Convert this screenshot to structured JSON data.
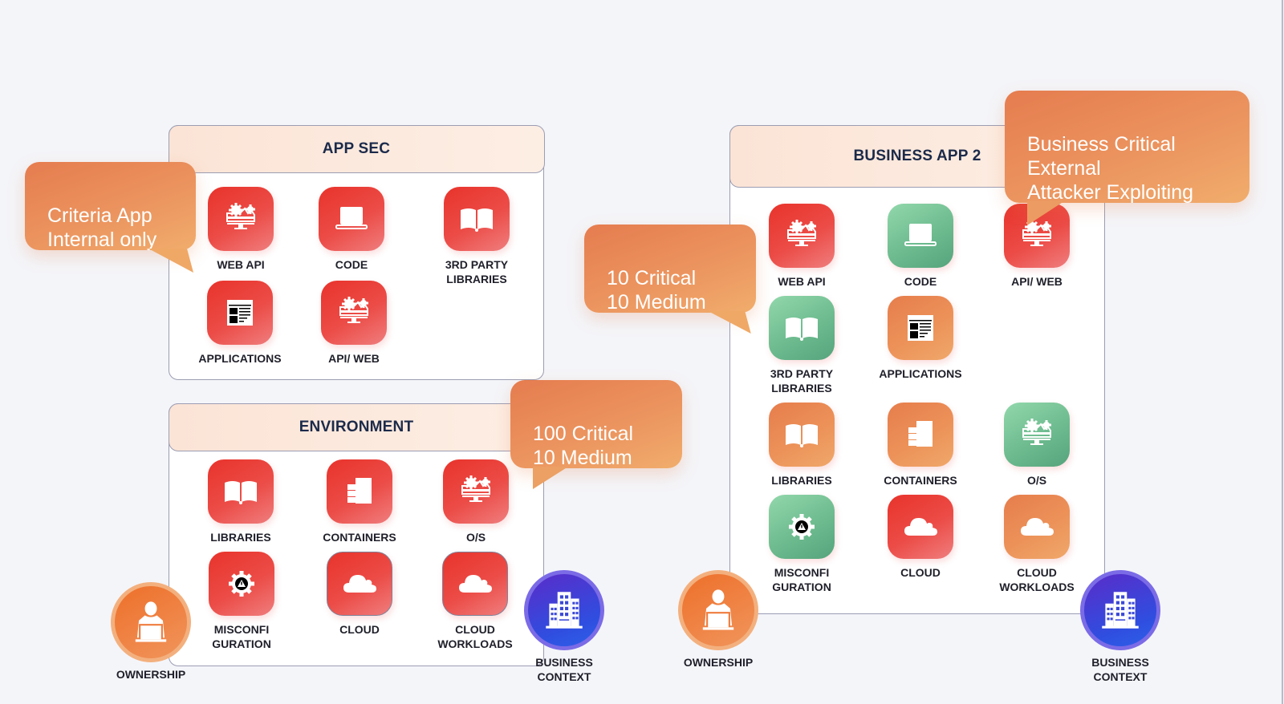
{
  "panels": {
    "app_sec": {
      "title": "APP SEC",
      "tiles": [
        {
          "label": "WEB API",
          "icon": "monitor-gears-icon",
          "color": "red"
        },
        {
          "label": "CODE",
          "icon": "laptop-code-icon",
          "color": "red"
        },
        {
          "label": "3RD PARTY\nLIBRARIES",
          "icon": "open-book-icon",
          "color": "red"
        },
        {
          "label": "APPLICATIONS",
          "icon": "app-window-icon",
          "color": "red"
        },
        {
          "label": "API/ WEB",
          "icon": "monitor-gears-icon",
          "color": "red"
        }
      ]
    },
    "environment": {
      "title": "ENVIRONMENT",
      "tiles": [
        {
          "label": "LIBRARIES",
          "icon": "open-book-icon",
          "color": "red"
        },
        {
          "label": "CONTAINERS",
          "icon": "server-stack-icon",
          "color": "red"
        },
        {
          "label": "O/S",
          "icon": "monitor-gears-icon",
          "color": "red"
        },
        {
          "label": "MISCONFI\nGURATION",
          "icon": "gear-warning-icon",
          "color": "red"
        },
        {
          "label": "CLOUD",
          "icon": "cloud-icon",
          "color": "red"
        },
        {
          "label": "CLOUD\nWORKLOADS",
          "icon": "cloud-icon",
          "color": "red"
        }
      ]
    },
    "business_app_2": {
      "title": "BUSINESS APP 2",
      "tiles": [
        {
          "label": "WEB API",
          "icon": "monitor-gears-icon",
          "color": "red"
        },
        {
          "label": "CODE",
          "icon": "laptop-code-icon",
          "color": "green"
        },
        {
          "label": "API/ WEB",
          "icon": "monitor-gears-icon",
          "color": "red"
        },
        {
          "label": "3RD PARTY\nLIBRARIES",
          "icon": "open-book-icon",
          "color": "green"
        },
        {
          "label": "APPLICATIONS",
          "icon": "app-window-icon",
          "color": "orange"
        },
        {
          "label": "LIBRARIES",
          "icon": "open-book-icon",
          "color": "orange"
        },
        {
          "label": "CONTAINERS",
          "icon": "server-stack-icon",
          "color": "orange"
        },
        {
          "label": "O/S",
          "icon": "monitor-gears-icon",
          "color": "green"
        },
        {
          "label": "MISCONFI\nGURATION",
          "icon": "gear-warning-icon",
          "color": "green"
        },
        {
          "label": "CLOUD",
          "icon": "cloud-icon",
          "color": "red"
        },
        {
          "label": "CLOUD\nWORKLOADS",
          "icon": "cloud-icon",
          "color": "orange"
        }
      ]
    }
  },
  "callouts": {
    "criteria": "Criteria App\nInternal only",
    "env_counts": "100 Critical\n10 Medium",
    "app2_counts": "10 Critical\n10 Medium",
    "business_critical": "Business Critical\nExternal\nAttacker Exploiting"
  },
  "badges": {
    "ownership_left": "OWNERSHIP",
    "business_context_left": "BUSINESS\nCONTEXT",
    "ownership_right": "OWNERSHIP",
    "business_context_right": "BUSINESS\nCONTEXT"
  },
  "colors": {
    "critical_red": "#e8332b",
    "medium_orange": "#ec9259",
    "low_green": "#6dbb8f",
    "callout_orange": "#e98a57",
    "business_purple": "#4a3ad6",
    "ownership_orange": "#ee7a3a"
  }
}
